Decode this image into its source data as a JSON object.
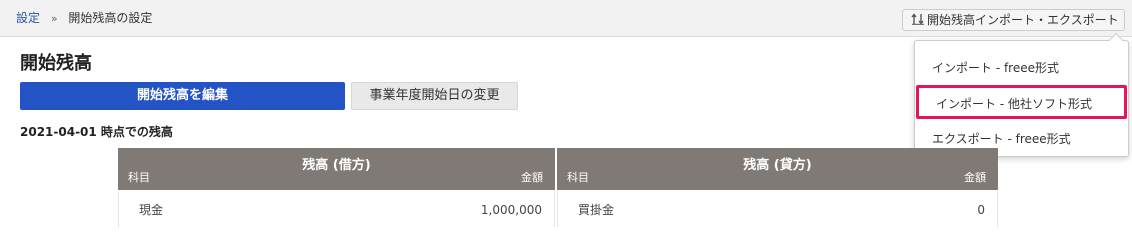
{
  "breadcrumb": {
    "root": "設定",
    "separator": "»",
    "current": "開始残高の設定"
  },
  "import_export_button": {
    "icon": "up-down-arrows-icon",
    "label": "開始残高インポート・エクスポート"
  },
  "dropdown": {
    "items": [
      {
        "label": "インポート - freee形式"
      },
      {
        "label": "インポート - 他社ソフト形式",
        "highlighted": true
      },
      {
        "label": "エクスポート - freee形式"
      }
    ],
    "highlight_color": "#e3165b"
  },
  "page": {
    "title": "開始残高",
    "edit_button": "開始残高を編集",
    "change_fy_button": "事業年度開始日の変更",
    "as_of_label": "2021-04-01 時点での残高"
  },
  "tables": {
    "debit": {
      "title": "残高 (借方)",
      "col_account": "科目",
      "col_amount": "金額",
      "rows": [
        {
          "account": "現金",
          "amount": "1,000,000"
        }
      ]
    },
    "credit": {
      "title": "残高 (貸方)",
      "col_account": "科目",
      "col_amount": "金額",
      "rows": [
        {
          "account": "買掛金",
          "amount": "0"
        }
      ]
    }
  },
  "colors": {
    "primary": "#2353c5",
    "table_header": "#7f7a75",
    "link": "#2a57a8"
  }
}
